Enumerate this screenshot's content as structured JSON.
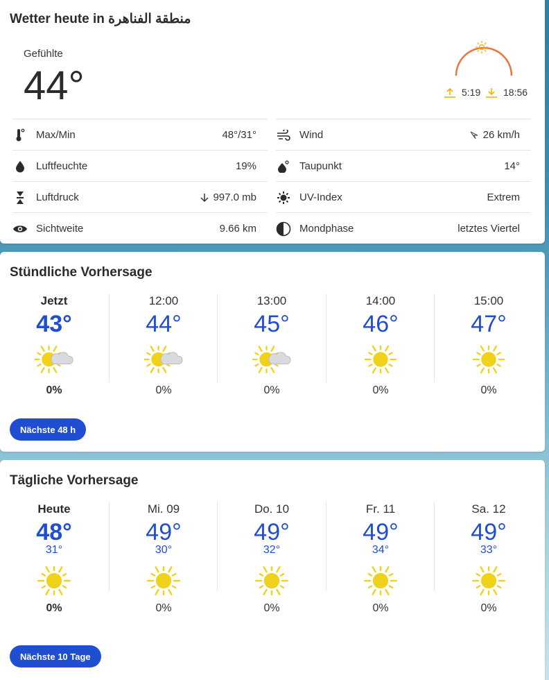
{
  "today": {
    "title": "Wetter heute in منطقة الفناهرة",
    "feels_label": "Gefühlte",
    "feels_value": "44°",
    "sunrise": "5:19",
    "sunset": "18:56",
    "details": [
      {
        "icon": "thermometer-icon",
        "label": "Max/Min",
        "value": "48°/31°"
      },
      {
        "icon": "wind-icon",
        "label": "Wind",
        "value": "26 km/h"
      },
      {
        "icon": "humidity-drop-icon",
        "label": "Luftfeuchte",
        "value": "19%"
      },
      {
        "icon": "dewpoint-icon",
        "label": "Taupunkt",
        "value": "14°"
      },
      {
        "icon": "pressure-icon",
        "label": "Luftdruck",
        "value": "997.0 mb"
      },
      {
        "icon": "uv-sun-icon",
        "label": "UV-Index",
        "value": "Extrem"
      },
      {
        "icon": "eye-icon",
        "label": "Sichtweite",
        "value": "9.66 km"
      },
      {
        "icon": "moon-phase-icon",
        "label": "Mondphase",
        "value": "letztes Viertel"
      }
    ]
  },
  "hourly": {
    "title": "Stündliche Vorhersage",
    "items": [
      {
        "label": "Jetzt",
        "temp": "43°",
        "icon": "partly-cloudy-sun-icon",
        "precip": "0%"
      },
      {
        "label": "12:00",
        "temp": "44°",
        "icon": "partly-cloudy-sun-icon",
        "precip": "0%"
      },
      {
        "label": "13:00",
        "temp": "45°",
        "icon": "partly-cloudy-sun-icon",
        "precip": "0%"
      },
      {
        "label": "14:00",
        "temp": "46°",
        "icon": "sun-icon",
        "precip": "0%"
      },
      {
        "label": "15:00",
        "temp": "47°",
        "icon": "sun-icon",
        "precip": "0%"
      }
    ],
    "more_label": "Nächste 48 h"
  },
  "daily": {
    "title": "Tägliche Vorhersage",
    "items": [
      {
        "label": "Heute",
        "high": "48°",
        "low": "31°",
        "icon": "sun-icon",
        "precip": "0%"
      },
      {
        "label": "Mi. 09",
        "high": "49°",
        "low": "30°",
        "icon": "sun-icon",
        "precip": "0%"
      },
      {
        "label": "Do. 10",
        "high": "49°",
        "low": "32°",
        "icon": "sun-icon",
        "precip": "0%"
      },
      {
        "label": "Fr. 11",
        "high": "49°",
        "low": "34°",
        "icon": "sun-icon",
        "precip": "0%"
      },
      {
        "label": "Sa. 12",
        "high": "49°",
        "low": "33°",
        "icon": "sun-icon",
        "precip": "0%"
      }
    ],
    "more_label": "Nächste 10 Tage"
  },
  "colors": {
    "accent": "#1f4ed0",
    "sun": "#f0d21a",
    "arc": "#e8753a",
    "sunrise_arrow": "#f5b000"
  }
}
